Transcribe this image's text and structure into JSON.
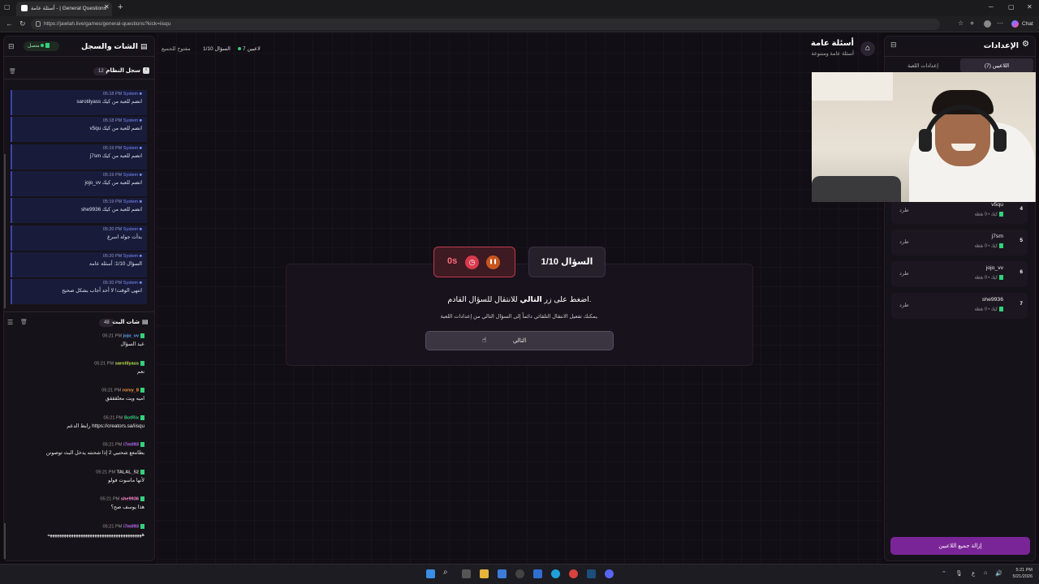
{
  "browser": {
    "tab_title": "أسئلة عامة - | General Questions",
    "url": "https://jawlah.live/games/general-questions?kick=iisqu",
    "chat_label": "Chat"
  },
  "header": {
    "title": "أسئلة عامة",
    "subtitle": "أسئلة عامة ومتنوعة",
    "players_status": "7 لاعبين",
    "question_status": "السؤال 1/10",
    "open_status": "مفتوح للجميع"
  },
  "left_panel": {
    "title": "الشات والسجل",
    "connection": "متصل",
    "system_log": {
      "title": "سجل النظام",
      "count": "12",
      "items": [
        {
          "sender": "System",
          "time": "05:18 PM",
          "message": "sarotilyass انضم للعبة من كيك"
        },
        {
          "sender": "System",
          "time": "05:18 PM",
          "message": "v5qu انضم للعبة من كيك"
        },
        {
          "sender": "System",
          "time": "05:19 PM",
          "message": "j7sm انضم للعبة من كيك"
        },
        {
          "sender": "System",
          "time": "05:19 PM",
          "message": "jojo_vv انضم للعبة من كيك"
        },
        {
          "sender": "System",
          "time": "05:19 PM",
          "message": "she9936 انضم للعبة من كيك"
        },
        {
          "sender": "System",
          "time": "05:20 PM",
          "message": "بدأت جولة اسرع"
        },
        {
          "sender": "System",
          "time": "05:20 PM",
          "message": "السؤال 1/10: أسئلة عامة"
        },
        {
          "sender": "System",
          "time": "05:20 PM",
          "message": "انتهى الوقت! لا أحد أجاب بشكل صحيح"
        }
      ]
    },
    "stream_chat": {
      "title": "شات البث",
      "count": "48",
      "items": [
        {
          "user": "jojo_vv",
          "time": "05:21 PM",
          "message": "عيد السؤال",
          "color": "#5aa6ff"
        },
        {
          "user": "sarotilyass",
          "time": "05:21 PM",
          "message": "نعم",
          "color": "#b8e34a"
        },
        {
          "user": "rorvy_8",
          "time": "05:21 PM",
          "message": "اميه ويت معلقققق",
          "color": "#ff9a3c"
        },
        {
          "user": "BotRix",
          "time": "05:21 PM",
          "message": "رابط الدعم https://creators.sa/iisqu",
          "color": "#33d17a"
        },
        {
          "user": "i7m093",
          "time": "05:21 PM",
          "message": "بطامعع شحنيي 2 إذا شحنته يدخل البث توصونن",
          "color": "#c070ff"
        },
        {
          "user": "TALAL_52",
          "time": "05:21 PM",
          "message": "لأنها ماسوت فولو",
          "color": "#cfcfcf"
        },
        {
          "user": "she9936",
          "time": "05:21 PM",
          "message": "هذا يوسف صح؟",
          "color": "#ff8bd0"
        },
        {
          "user": "i7m093",
          "time": "05:21 PM",
          "message": "ههههههههههههههههههههههههههههههههههههههههه",
          "color": "#c070ff"
        }
      ]
    }
  },
  "game": {
    "timer": "0s",
    "question_badge": "السؤال 1/10",
    "instruction_prefix": "اضغط على زر ",
    "instruction_bold": "التالي",
    "instruction_suffix": " للانتقال للسؤال القادم.",
    "hint": "يمكنك تفعيل الانتقال التلقائي دائماً إلى السؤال التالي من إعدادات اللعبة.",
    "next_button": "التالي"
  },
  "right_panel": {
    "title": "الإعدادات",
    "tabs": [
      "اللاعبين (7)",
      "إعدادات اللعبة"
    ],
    "players": [
      {
        "rank": "4",
        "name": "v5qu",
        "points": "كيك • 0 نقطة",
        "kick": "طرد"
      },
      {
        "rank": "5",
        "name": "j7sm",
        "points": "كيك • 0 نقطة",
        "kick": "طرد"
      },
      {
        "rank": "6",
        "name": "jojo_vv",
        "points": "كيك • 0 نقطة",
        "kick": "طرد"
      },
      {
        "rank": "7",
        "name": "she9936",
        "points": "كيك • 0 نقطة",
        "kick": "طرد"
      }
    ],
    "remove_all": "إزالة جميع اللاعبين"
  },
  "taskbar": {
    "time": "5:21 PM",
    "date": "5/21/2026",
    "lang": "ع"
  }
}
